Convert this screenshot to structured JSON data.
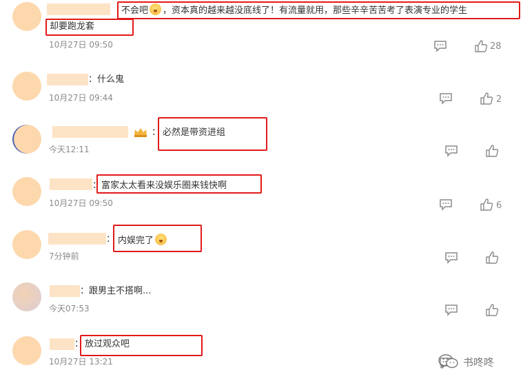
{
  "comments": [
    {
      "text": "不会吧",
      "text_after": "，资本真的越来越没底线了！有流量就用，那些辛辛苦苦考了表演专业的学生",
      "text_line2": "却要跑龙套",
      "time": "10月27日 09:50",
      "likes": "28"
    },
    {
      "text": "什么鬼",
      "time": "10月27日 09:44",
      "likes": "2"
    },
    {
      "text": "必然是带资进组",
      "time": "今天12:11",
      "likes": ""
    },
    {
      "text": "富家太太看来没娱乐圈来钱快啊",
      "time": "10月27日 09:50",
      "likes": "6"
    },
    {
      "text": "内娱完了",
      "time": "7分钟前",
      "likes": ""
    },
    {
      "text": "跟男主不搭啊...",
      "time": "今天07:53",
      "likes": ""
    },
    {
      "text": "放过观众吧",
      "time": "10月27日 13:21",
      "likes": ""
    }
  ],
  "colon": "：",
  "watermark": {
    "text": "书咚咚",
    "icon": "wechat-icon"
  },
  "icons": {
    "reply": "comment-bubble-icon",
    "like": "thumbs-up-icon",
    "emoji": "smiley-emoji",
    "badge": "crown-badge-icon"
  },
  "colors": {
    "highlight_box": "#e11919",
    "avatar": "#fdd8ad",
    "name_mask": "#fde3c6",
    "time": "#8a8a8a"
  }
}
